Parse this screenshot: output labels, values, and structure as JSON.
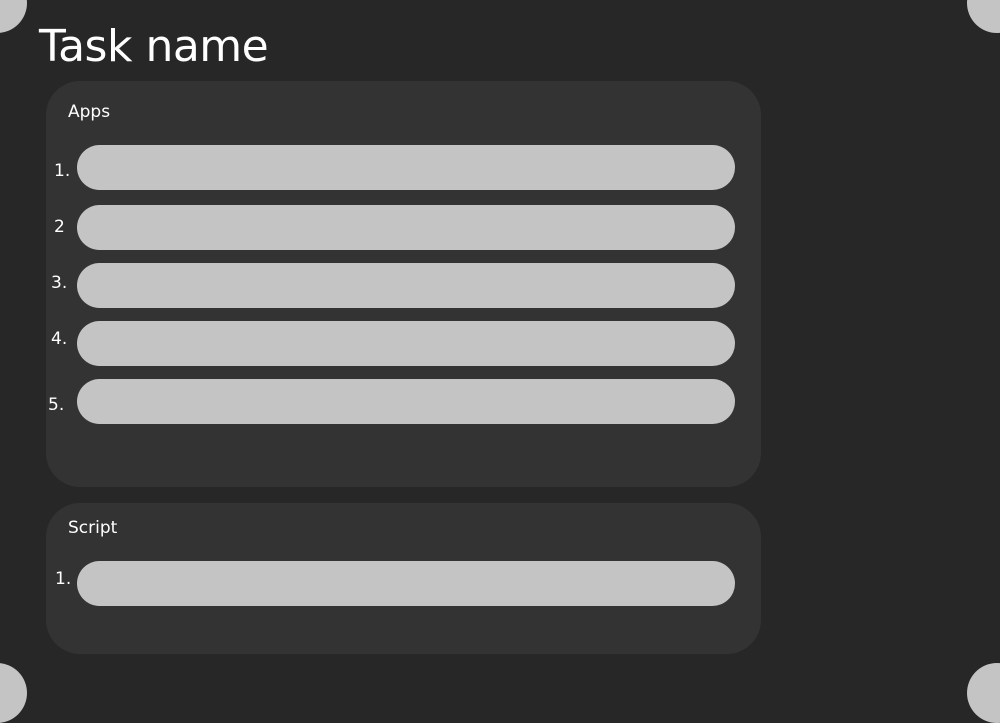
{
  "page": {
    "title": "Task name"
  },
  "apps": {
    "label": "Apps",
    "items": [
      {
        "number": "1.",
        "value": ""
      },
      {
        "number": "2",
        "value": ""
      },
      {
        "number": "3.",
        "value": ""
      },
      {
        "number": "4.",
        "value": ""
      },
      {
        "number": "5.",
        "value": ""
      }
    ]
  },
  "script": {
    "label": "Script",
    "items": [
      {
        "number": "1.",
        "value": ""
      }
    ]
  },
  "colors": {
    "background": "#272727",
    "panel": "#333333",
    "input": "#c4c4c4",
    "text": "#ffffff"
  }
}
